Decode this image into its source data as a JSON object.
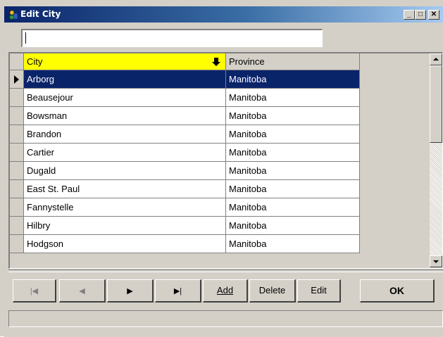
{
  "window": {
    "title": "Edit City",
    "controls": {
      "minimize": "_",
      "maximize": "□",
      "close": "✕"
    }
  },
  "search": {
    "value": "",
    "placeholder": ""
  },
  "grid": {
    "columns": [
      "City",
      "Province"
    ],
    "sorted_column": "City",
    "rows": [
      {
        "city": "Arborg",
        "province": "Manitoba"
      },
      {
        "city": "Beausejour",
        "province": "Manitoba"
      },
      {
        "city": "Bowsman",
        "province": "Manitoba"
      },
      {
        "city": "Brandon",
        "province": "Manitoba"
      },
      {
        "city": "Cartier",
        "province": "Manitoba"
      },
      {
        "city": "Dugald",
        "province": "Manitoba"
      },
      {
        "city": "East St. Paul",
        "province": "Manitoba"
      },
      {
        "city": "Fannystelle",
        "province": "Manitoba"
      },
      {
        "city": "Hilbry",
        "province": "Manitoba"
      },
      {
        "city": "Hodgson",
        "province": "Manitoba"
      }
    ],
    "selected_row": 0
  },
  "toolbar": {
    "nav": {
      "first": "|◀",
      "prev": "◀",
      "next": "▶",
      "last": "▶|"
    },
    "add_label": "Add",
    "delete_label": "Delete",
    "edit_label": "Edit",
    "ok_label": "OK"
  },
  "colors": {
    "title_gradient_start": "#0a246a",
    "title_gradient_end": "#a6caf0",
    "sorted_header": "#ffff00",
    "selection": "#0a246a",
    "face": "#d4d0c8"
  },
  "icons": {
    "app": "city-app-icon",
    "sort": "sort-descending-arrow-icon",
    "row_pointer": "current-row-pointer-icon"
  }
}
